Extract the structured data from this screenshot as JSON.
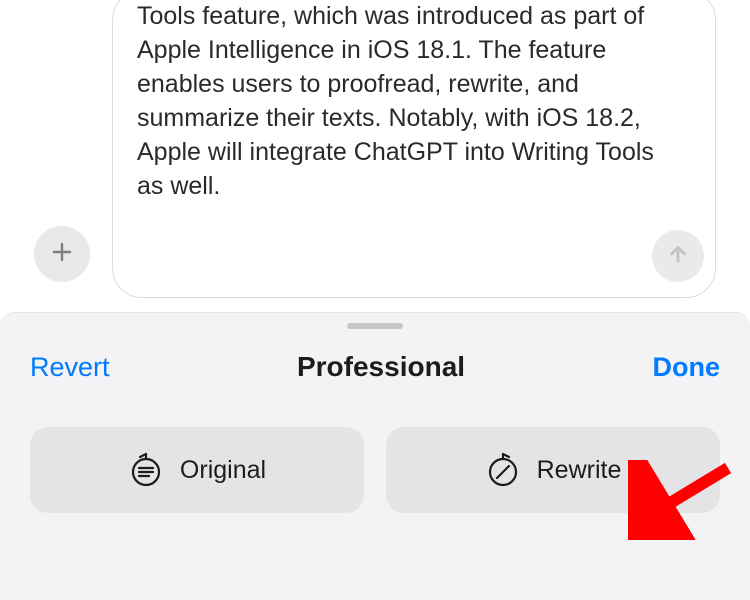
{
  "compose": {
    "text": "Tools feature, which was introduced as part of Apple Intelligence in iOS 18.1. The feature enables users to proofread, rewrite, and summarize their texts. Notably, with iOS 18.2, Apple will integrate ChatGPT into Writing Tools as well."
  },
  "panel": {
    "revert_label": "Revert",
    "title": "Professional",
    "done_label": "Done",
    "original_label": "Original",
    "rewrite_label": "Rewrite"
  }
}
